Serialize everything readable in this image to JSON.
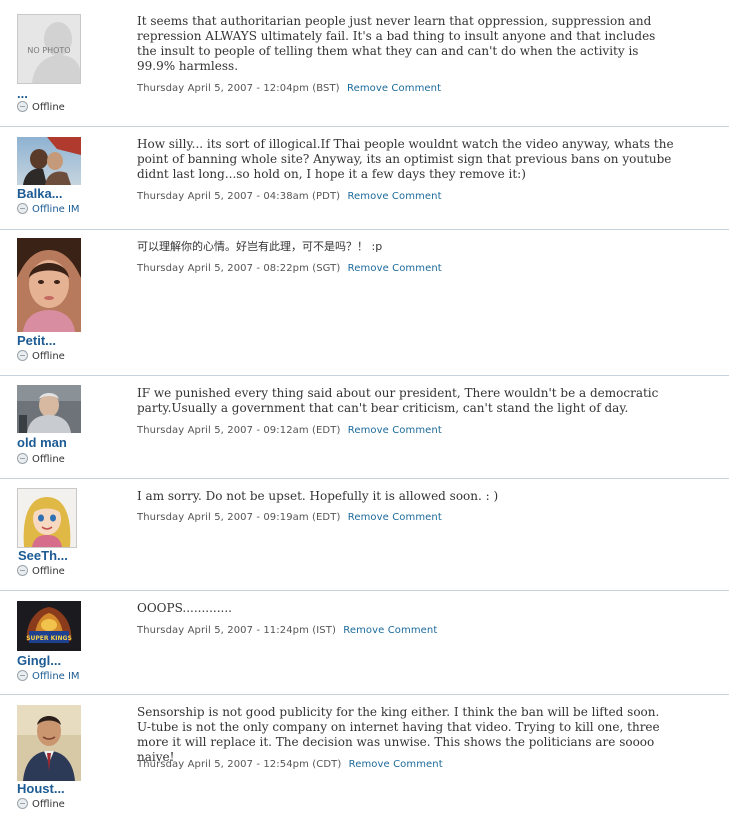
{
  "remove_label": "Remove Comment",
  "comments": [
    {
      "username": "...",
      "status": "Offline",
      "avatar": "no-photo",
      "avatar_text": "NO PHOTO",
      "text": "It seems that authoritarian people just never learn that oppression, suppression and repression ALWAYS ultimately fail. It's a bad thing to insult anyone and that includes the insult to people of telling them what they can and can't do when the activity is 99.9% harmless.",
      "date": "Thursday April 5, 2007 - 12:04pm (BST)"
    },
    {
      "username": "Balka...",
      "status": "Offline IM",
      "avatar": "couple-photo",
      "text": "How silly... its sort of illogical.If Thai people wouldnt watch the video anyway, whats the point of banning whole site? Anyway, its an optimist sign that previous bans on youtube didnt last long...so hold on, I hope it a few days they remove it:)",
      "date": "Thursday April 5, 2007 - 04:38am (PDT)"
    },
    {
      "username": "Petit...",
      "status": "Offline",
      "avatar": "child-photo",
      "text": "可以理解你的心情。好岂有此理，可不是吗？！ :p",
      "date": "Thursday April 5, 2007 - 08:22pm (SGT)"
    },
    {
      "username": "old man",
      "status": "Offline",
      "avatar": "old-man-photo",
      "text": "IF we punished every thing said about our president, There wouldn't be a democratic party.Usually a government that can't bear criticism, can't stand the light of day.",
      "date": "Thursday April 5, 2007 - 09:12am (EDT)"
    },
    {
      "username": "SeeTh...",
      "status": "Offline",
      "avatar": "cartoon-girl",
      "text": "I am sorry. Do not be upset. Hopefully it is allowed soon. : )",
      "date": "Thursday April 5, 2007 - 09:19am (EDT)"
    },
    {
      "username": "Gingl...",
      "status": "Offline IM",
      "avatar": "super-kings-logo",
      "avatar_text": "SUPER KINGS",
      "text": "OOOPS.............",
      "date": "Thursday April 5, 2007 - 11:24pm (IST)"
    },
    {
      "username": "Houst...",
      "status": "Offline",
      "avatar": "man-suit-photo",
      "text": "Sensorship is not good publicity for the king either. I think the ban will be lifted soon. U-tube is not the only company on internet having that video. Trying to kill one, three more it will replace it. The decision was unwise. This shows the politicians are soooo naive!",
      "date": "Thursday April 5, 2007 - 12:54pm (CDT)"
    }
  ]
}
